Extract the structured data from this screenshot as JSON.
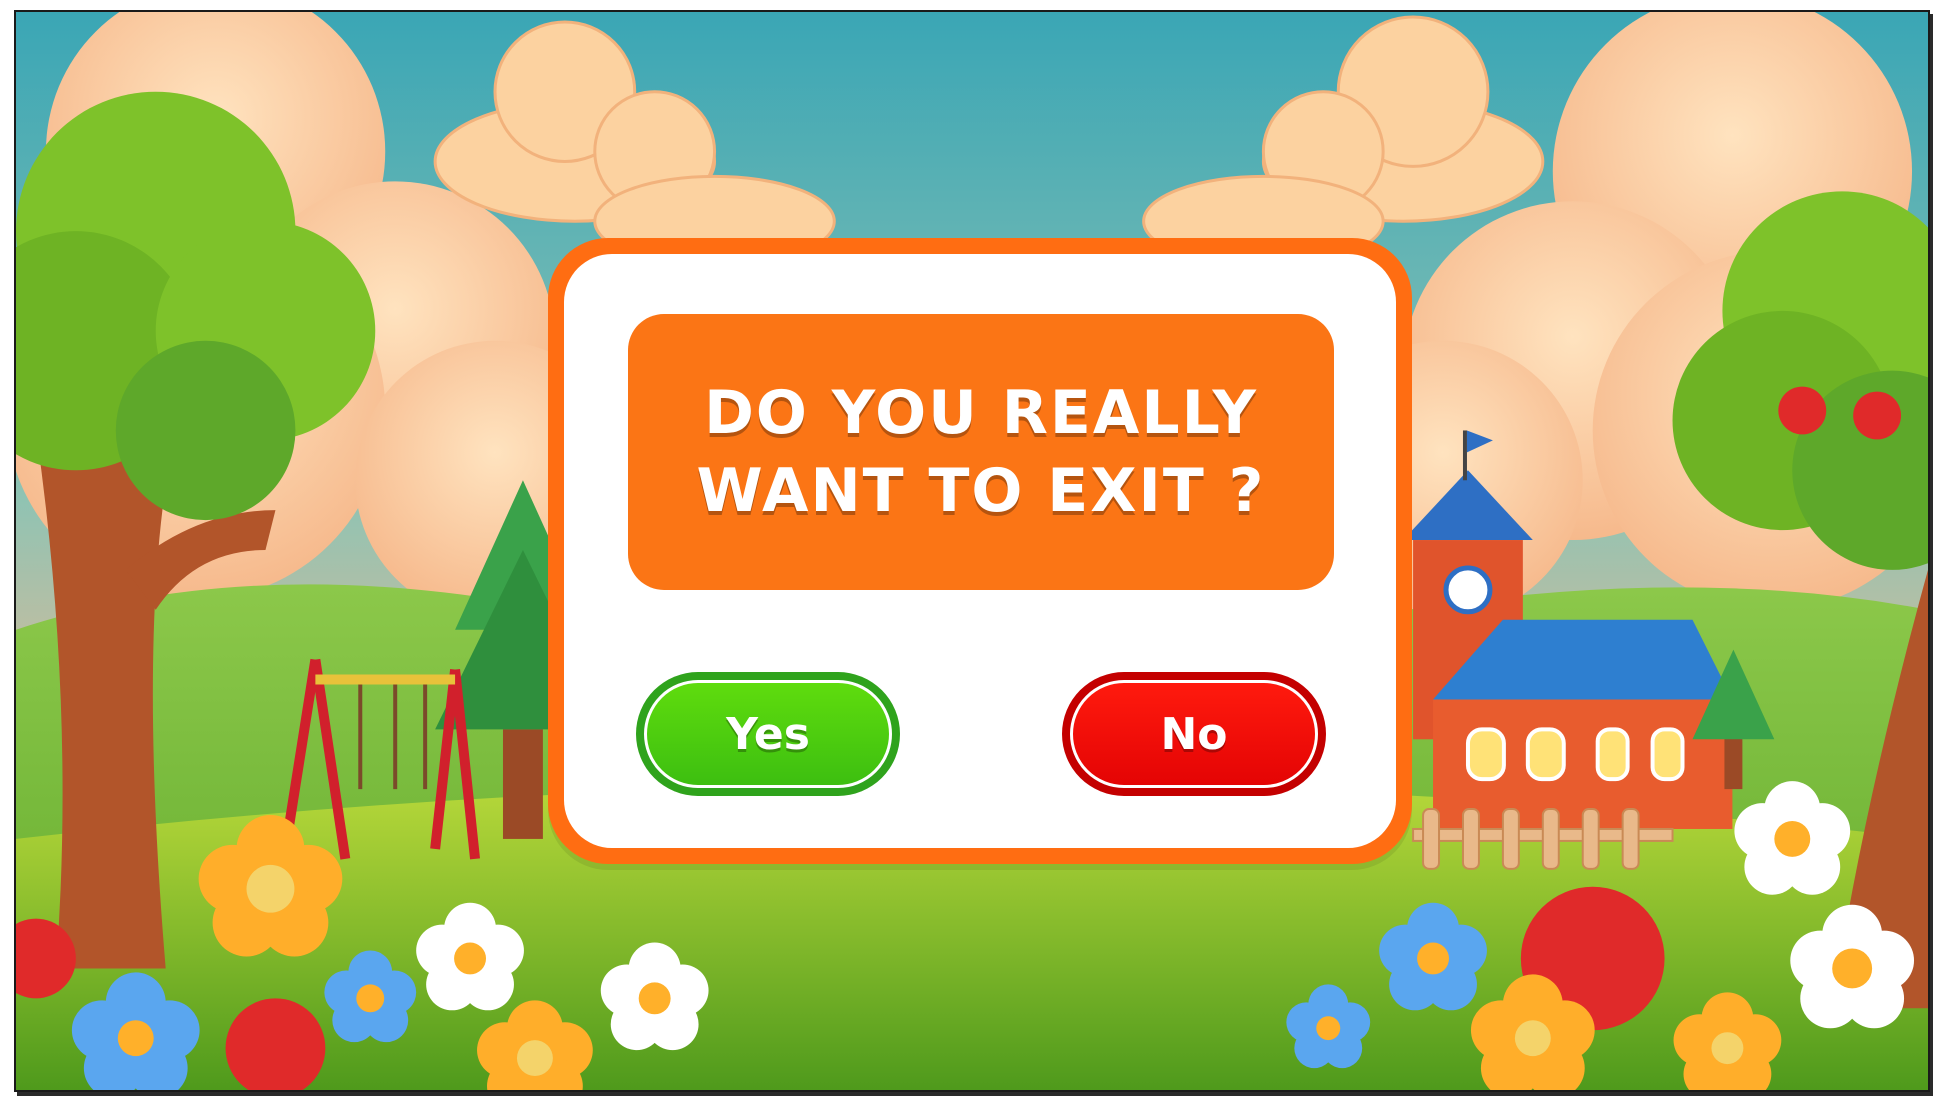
{
  "dialog": {
    "title_line1": "DO YOU REALLY",
    "title_line2": "WANT TO EXIT ?",
    "yes_label": "Yes",
    "no_label": "No"
  },
  "colors": {
    "dialog_border": "#ff6d12",
    "title_banner": "#fb7515",
    "yes_button": "#3dbf10",
    "no_button": "#e40404"
  },
  "scene": {
    "description_icons": [
      "cloud-icon",
      "tree-icon",
      "swing-icon",
      "school-icon",
      "flower-icon",
      "apple-icon",
      "pine-tree-icon"
    ]
  }
}
